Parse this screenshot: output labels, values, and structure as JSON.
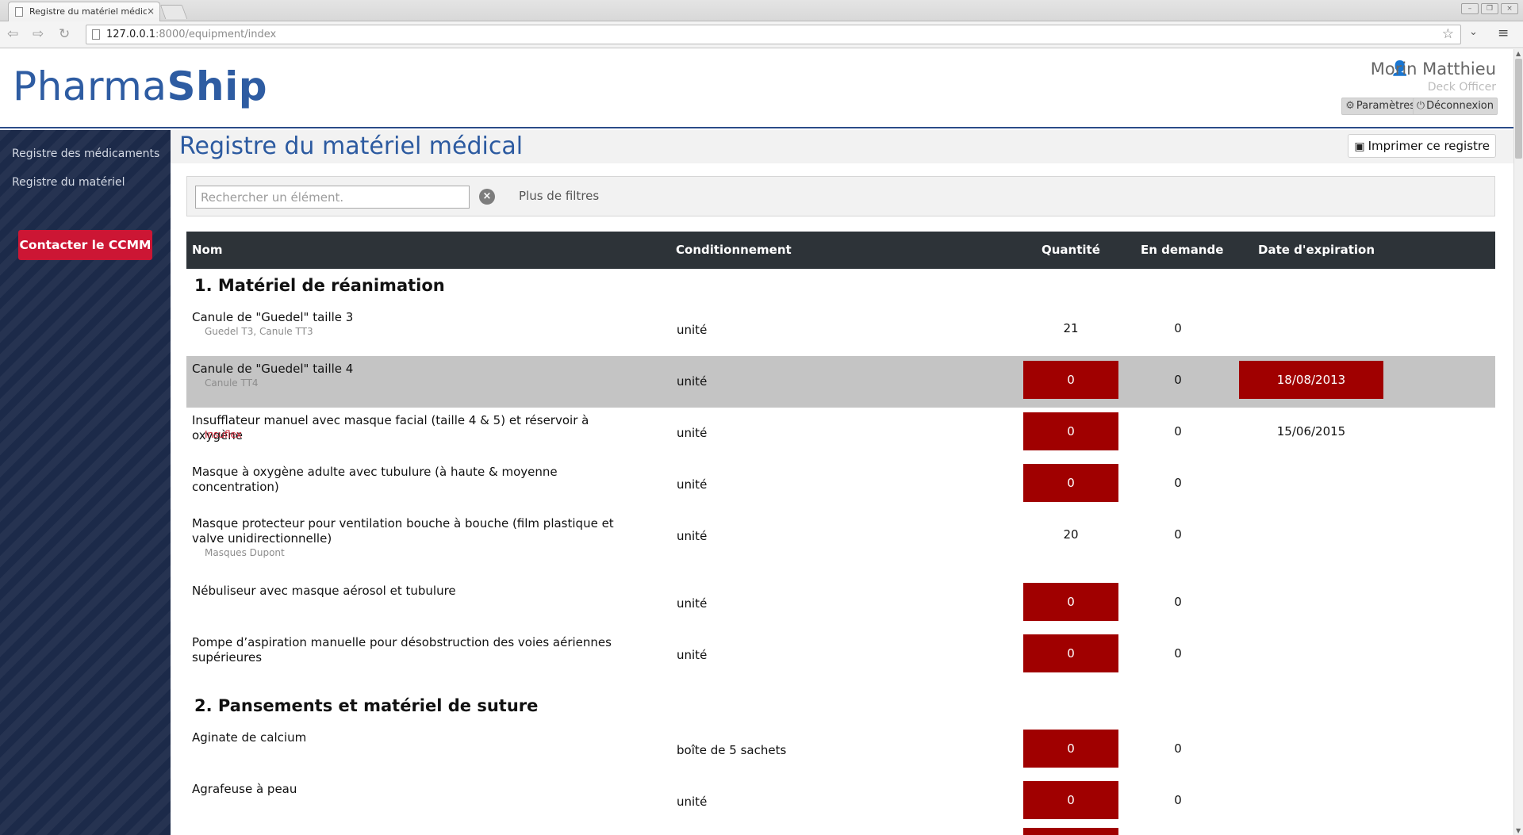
{
  "browser": {
    "tab_title": "Registre du matériel médic",
    "tab_close": "×",
    "url_host": "127.0.0.1",
    "url_rest": ":8000/equipment/index"
  },
  "header": {
    "logo_light": "Pharma",
    "logo_bold": "Ship",
    "user_name": "Morin Matthieu",
    "user_role": "Deck Officer",
    "settings_label": "Paramètres",
    "logout_label": "Déconnexion"
  },
  "sidebar": {
    "items": [
      {
        "label": "Registre des médicaments"
      },
      {
        "label": "Registre du matériel"
      }
    ],
    "contact_label": "Contacter le CCMM"
  },
  "main": {
    "title": "Registre du matériel médical",
    "print_label": "Imprimer ce registre",
    "search_placeholder": "Rechercher un élément.",
    "more_filters": "Plus de filtres",
    "columns": {
      "name": "Nom",
      "packaging": "Conditionnement",
      "quantity": "Quantité",
      "requested": "En demande",
      "expiry": "Date d'expiration"
    },
    "sections": [
      {
        "title": "1. Matériel de réanimation",
        "rows": [
          {
            "name": "Canule de \"Guedel\" taille 3",
            "sub": "Guedel T3, Canule TT3",
            "packaging": "unité",
            "quantity": "21",
            "requested": "0",
            "expiry": ""
          },
          {
            "name": "Canule de \"Guedel\" taille 4",
            "sub": "Canule TT4",
            "packaging": "unité",
            "quantity": "0",
            "requested": "0",
            "expiry": "18/08/2013"
          },
          {
            "name": "Insufflateur manuel avec masque facial (taille 4 & 5) et réservoir à oxygène",
            "sub": "Insuflex",
            "packaging": "unité",
            "quantity": "0",
            "requested": "0",
            "expiry": "15/06/2015"
          },
          {
            "name": "Masque à oxygène adulte avec tubulure (à haute & moyenne concentration)",
            "sub": "",
            "packaging": "unité",
            "quantity": "0",
            "requested": "0",
            "expiry": ""
          },
          {
            "name": "Masque protecteur pour ventilation bouche à bouche (film plastique et valve unidirectionnelle)",
            "sub": "Masques Dupont",
            "packaging": "unité",
            "quantity": "20",
            "requested": "0",
            "expiry": ""
          },
          {
            "name": "Nébuliseur avec masque aérosol et tubulure",
            "sub": "",
            "packaging": "unité",
            "quantity": "0",
            "requested": "0",
            "expiry": ""
          },
          {
            "name": "Pompe d’aspiration manuelle pour désobstruction des voies aériennes supérieures",
            "sub": "",
            "packaging": "unité",
            "quantity": "0",
            "requested": "0",
            "expiry": ""
          }
        ]
      },
      {
        "title": "2. Pansements et matériel de suture",
        "rows": [
          {
            "name": "Aginate de calcium",
            "sub": "",
            "packaging": "boîte de 5 sachets",
            "quantity": "0",
            "requested": "0",
            "expiry": ""
          },
          {
            "name": "Agrafeuse à peau",
            "sub": "",
            "packaging": "unité",
            "quantity": "0",
            "requested": "0",
            "expiry": ""
          }
        ]
      }
    ]
  },
  "colors": {
    "brand_blue": "#2e5ca2",
    "sidebar_bg": "#1c2a49",
    "contact_red": "#cc1634",
    "alert_red": "#a00000",
    "table_header": "#2d3338",
    "highlight_row": "#c4c4c4"
  },
  "icons": {
    "user": "user-icon",
    "settings": "gear-icon",
    "logout": "power-icon",
    "print": "printer-icon",
    "clear": "clear-circle-icon",
    "bookmark": "star-icon"
  }
}
